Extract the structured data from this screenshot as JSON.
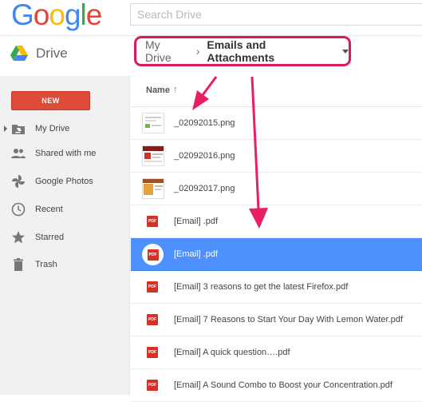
{
  "header": {
    "logo": [
      "G",
      "o",
      "o",
      "g",
      "l",
      "e"
    ],
    "search_placeholder": "Search Drive"
  },
  "drive": {
    "title": "Drive",
    "breadcrumb_root": "My Drive",
    "breadcrumb_sep": "›",
    "breadcrumb_current": "Emails and Attachments"
  },
  "sidebar": {
    "new_label": "NEW",
    "items": [
      {
        "label": "My Drive",
        "icon": "drive-folder-icon"
      },
      {
        "label": "Shared with me",
        "icon": "people-icon"
      },
      {
        "label": "Google Photos",
        "icon": "pinwheel-icon"
      },
      {
        "label": "Recent",
        "icon": "clock-icon"
      },
      {
        "label": "Starred",
        "icon": "star-icon"
      },
      {
        "label": "Trash",
        "icon": "trash-icon"
      }
    ]
  },
  "list": {
    "column_name": "Name",
    "sort_arrow": "↑",
    "files": [
      {
        "name": "_02092015.png",
        "type": "image"
      },
      {
        "name": "_02092016.png",
        "type": "image"
      },
      {
        "name": "_02092017.png",
        "type": "image"
      },
      {
        "name": "[Email] .pdf",
        "type": "pdf"
      },
      {
        "name": "[Email] .pdf",
        "type": "pdf",
        "selected": true
      },
      {
        "name": "[Email] 3 reasons to get the latest Firefox.pdf",
        "type": "pdf"
      },
      {
        "name": "[Email] 7 Reasons to Start Your Day With Lemon Water.pdf",
        "type": "pdf"
      },
      {
        "name": "[Email] A quick question….pdf",
        "type": "pdf"
      },
      {
        "name": "[Email] A Sound Combo to Boost your Concentration.pdf",
        "type": "pdf"
      }
    ],
    "pdf_badge": "PDF"
  },
  "colors": {
    "accent_pink": "#d81b60",
    "selected_row": "#4d90fe",
    "new_button": "#dd4b39",
    "pdf_red": "#d93025"
  }
}
